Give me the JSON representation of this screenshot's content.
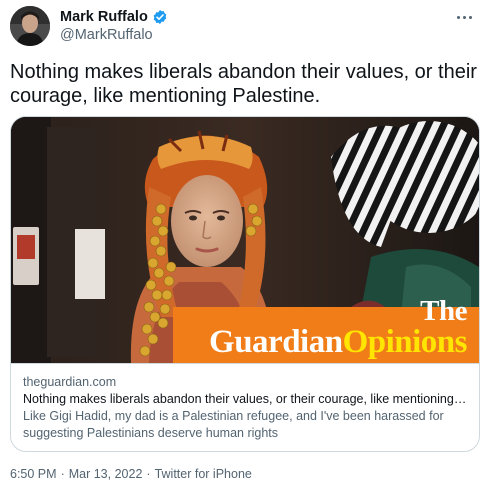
{
  "author": {
    "display_name": "Mark Ruffalo",
    "handle": "@MarkRuffalo",
    "verified": true
  },
  "tweet": {
    "text": "Nothing makes liberals abandon their values, or their courage, like mentioning Palestine."
  },
  "card": {
    "brand_the": "The",
    "brand_guardian": "Guardian",
    "brand_opinions": "Opinions",
    "domain": "theguardian.com",
    "title": "Nothing makes liberals abandon their values, or their courage, like mentioning Palestine",
    "description": "Like Gigi Hadid, my dad is a Palestinian refugee, and I've been harassed for suggesting Palestinians deserve human rights"
  },
  "meta": {
    "time": "6:50 PM",
    "date": "Mar 13, 2022",
    "separator": "·",
    "source": "Twitter for iPhone"
  },
  "icons": {
    "verified": "verified-badge-icon",
    "more": "more-options-icon"
  },
  "colors": {
    "verified_blue": "#1d9bf0",
    "brand_orange": "#f07d18",
    "brand_yellow": "#ffe500",
    "text_primary": "#0f1419",
    "text_secondary": "#536471"
  }
}
